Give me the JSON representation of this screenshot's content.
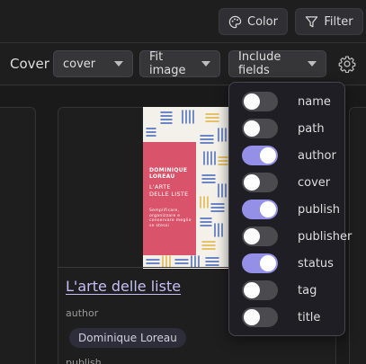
{
  "toolbar": {
    "color_label": "Color",
    "filter_label": "Filter"
  },
  "settings": {
    "cover_label": "Cover",
    "cover_select": "cover",
    "fit_select": "Fit image",
    "fields_select": "Include fields"
  },
  "fields": [
    {
      "label": "name",
      "on": false
    },
    {
      "label": "path",
      "on": false
    },
    {
      "label": "author",
      "on": true
    },
    {
      "label": "cover",
      "on": false
    },
    {
      "label": "publish",
      "on": true
    },
    {
      "label": "publisher",
      "on": false
    },
    {
      "label": "status",
      "on": true
    },
    {
      "label": "tag",
      "on": false
    },
    {
      "label": "title",
      "on": false
    }
  ],
  "book": {
    "cover_author": "DOMINIQUE LOREAU",
    "cover_title": "L'ARTE DELLE LISTE",
    "cover_subtitle": "Semplificare, organizzare e conservare meglio se stessi",
    "title": "L'arte delle liste",
    "author_label": "author",
    "author_value": "Dominique Loreau",
    "next_label": "publish"
  },
  "colors": {
    "accent": "#9490e8",
    "link": "#c6bff6",
    "cover_red": "#d9536a"
  }
}
